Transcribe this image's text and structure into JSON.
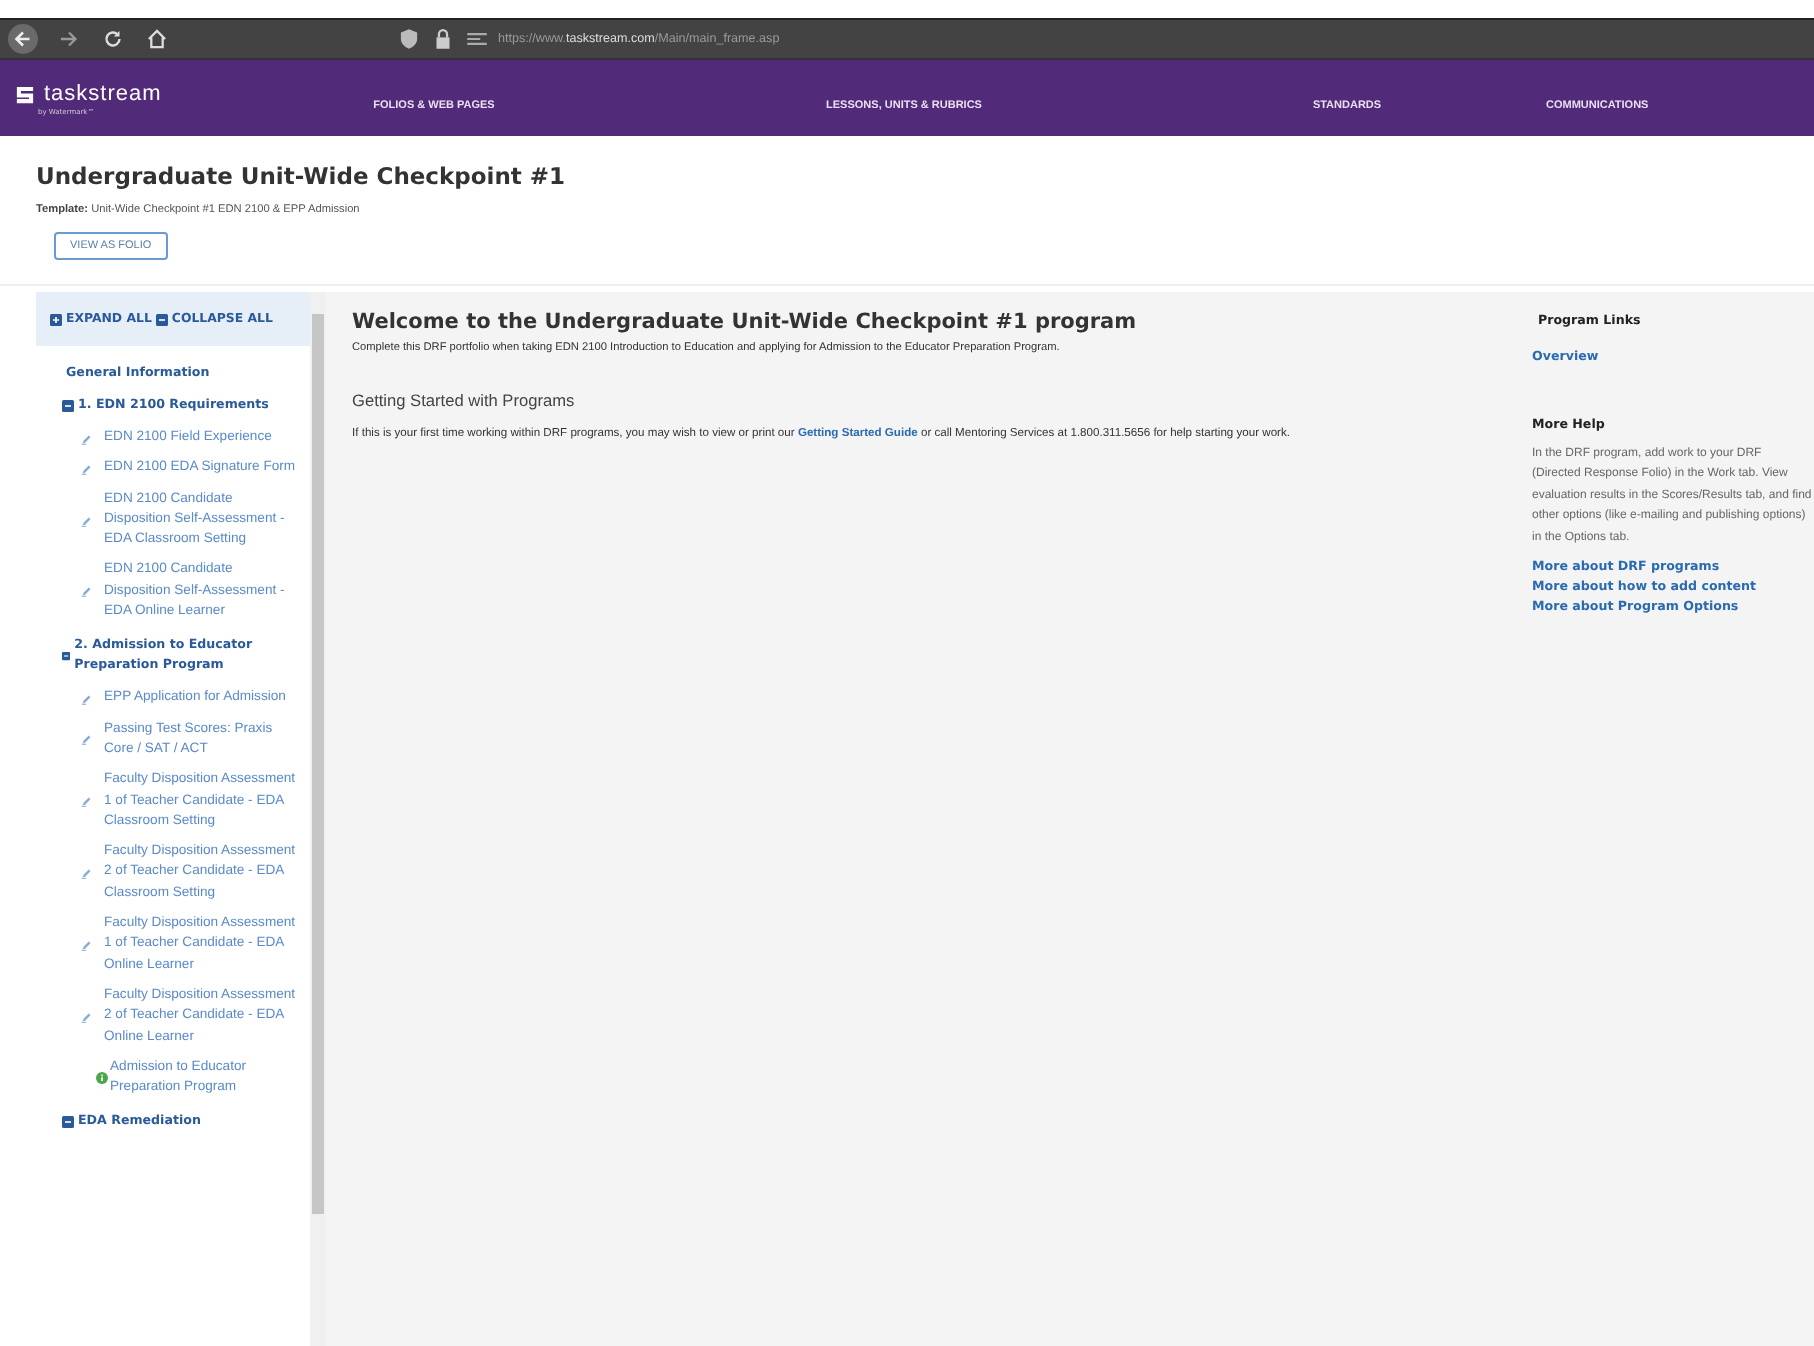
{
  "browser": {
    "url": "https://www.**taskstream.com**/Main/main_frame.asp"
  },
  "nav": {
    "logo": "taskstream",
    "logo_sub": "by Watermark™",
    "items": [
      {
        "label": "FOLIOS & WEB PAGES",
        "selected": false
      },
      {
        "label": "LESSONS, UNITS & RUBRICS",
        "selected": false
      },
      {
        "label": "STANDARDS",
        "selected": false
      },
      {
        "label": "COMMUNICATIONS",
        "selected": false
      }
    ]
  },
  "page": {
    "title": "Undergraduate Unit-Wide Checkpoint #1",
    "template_label": "Template:",
    "template": "Unit-Wide Checkpoint #1 EDN 2100 & EPP Admission",
    "button": "VIEW AS FOLIO"
  },
  "sidebar": {
    "expand_all": "EXPAND ALL",
    "collapse_all": "COLLAPSE ALL",
    "items": [
      {
        "kind": "heading",
        "label": "General Information"
      },
      {
        "kind": "section",
        "label": "1. EDN 2100 Requirements",
        "expanded": true,
        "children": [
          {
            "kind": "task",
            "label": "EDN 2100 Field Experience"
          },
          {
            "kind": "task",
            "label": "EDN 2100 EDA Signature Form"
          },
          {
            "kind": "task",
            "label": "EDN 2100 Candidate Disposition Self-Assessment - EDA Classroom Setting"
          },
          {
            "kind": "task",
            "label": "EDN 2100 Candidate Disposition Self-Assessment - EDA Online Learner"
          }
        ]
      },
      {
        "kind": "section",
        "label": "2. Admission to Educator Preparation Program",
        "expanded": true,
        "children": [
          {
            "kind": "task",
            "label": "EPP Application for Admission"
          },
          {
            "kind": "task",
            "label": "Passing Test Scores: Praxis Core / SAT / ACT"
          },
          {
            "kind": "task",
            "label": "Faculty Disposition Assessment 1 of Teacher Candidate - EDA Classroom Setting"
          },
          {
            "kind": "task",
            "label": "Faculty Disposition Assessment 2 of Teacher Candidate - EDA Classroom Setting"
          },
          {
            "kind": "task",
            "label": "Faculty Disposition Assessment 1 of Teacher Candidate - EDA Online Learner"
          },
          {
            "kind": "task",
            "label": "Faculty Disposition Assessment 2 of Teacher Candidate - EDA Online Learner"
          },
          {
            "kind": "info",
            "label": "Admission to Educator Preparation Program"
          }
        ]
      },
      {
        "kind": "section",
        "label": "EDA Remediation",
        "expanded": true
      }
    ]
  },
  "main": {
    "heading": "Welcome to the Undergraduate Unit-Wide Checkpoint #1 program",
    "subtitle": "Complete this DRF portfolio when taking EDN 2100 Introduction to Education and applying for Admission to the Educator Preparation Program.",
    "section_heading": "Getting Started with Programs",
    "intro_before": "If this is your first time working within DRF programs, you may wish to view or print our",
    "intro_link": "Getting Started Guide",
    "intro_after": "or call Mentoring Services at 1.800.311.5656 for help starting your work."
  },
  "aside": {
    "links_heading": "Program Links",
    "links": [
      "Overview"
    ],
    "help_heading": "More Help",
    "help_text": "In the DRF program, add work to your DRF (Directed Response Folio) in the Work tab. View evaluation results in the Scores/Results tab, and find other options (like e-mailing and publishing options) in the Options tab.",
    "help_links": [
      "More about DRF programs",
      "More about how to add content",
      "More about Program Options"
    ]
  }
}
